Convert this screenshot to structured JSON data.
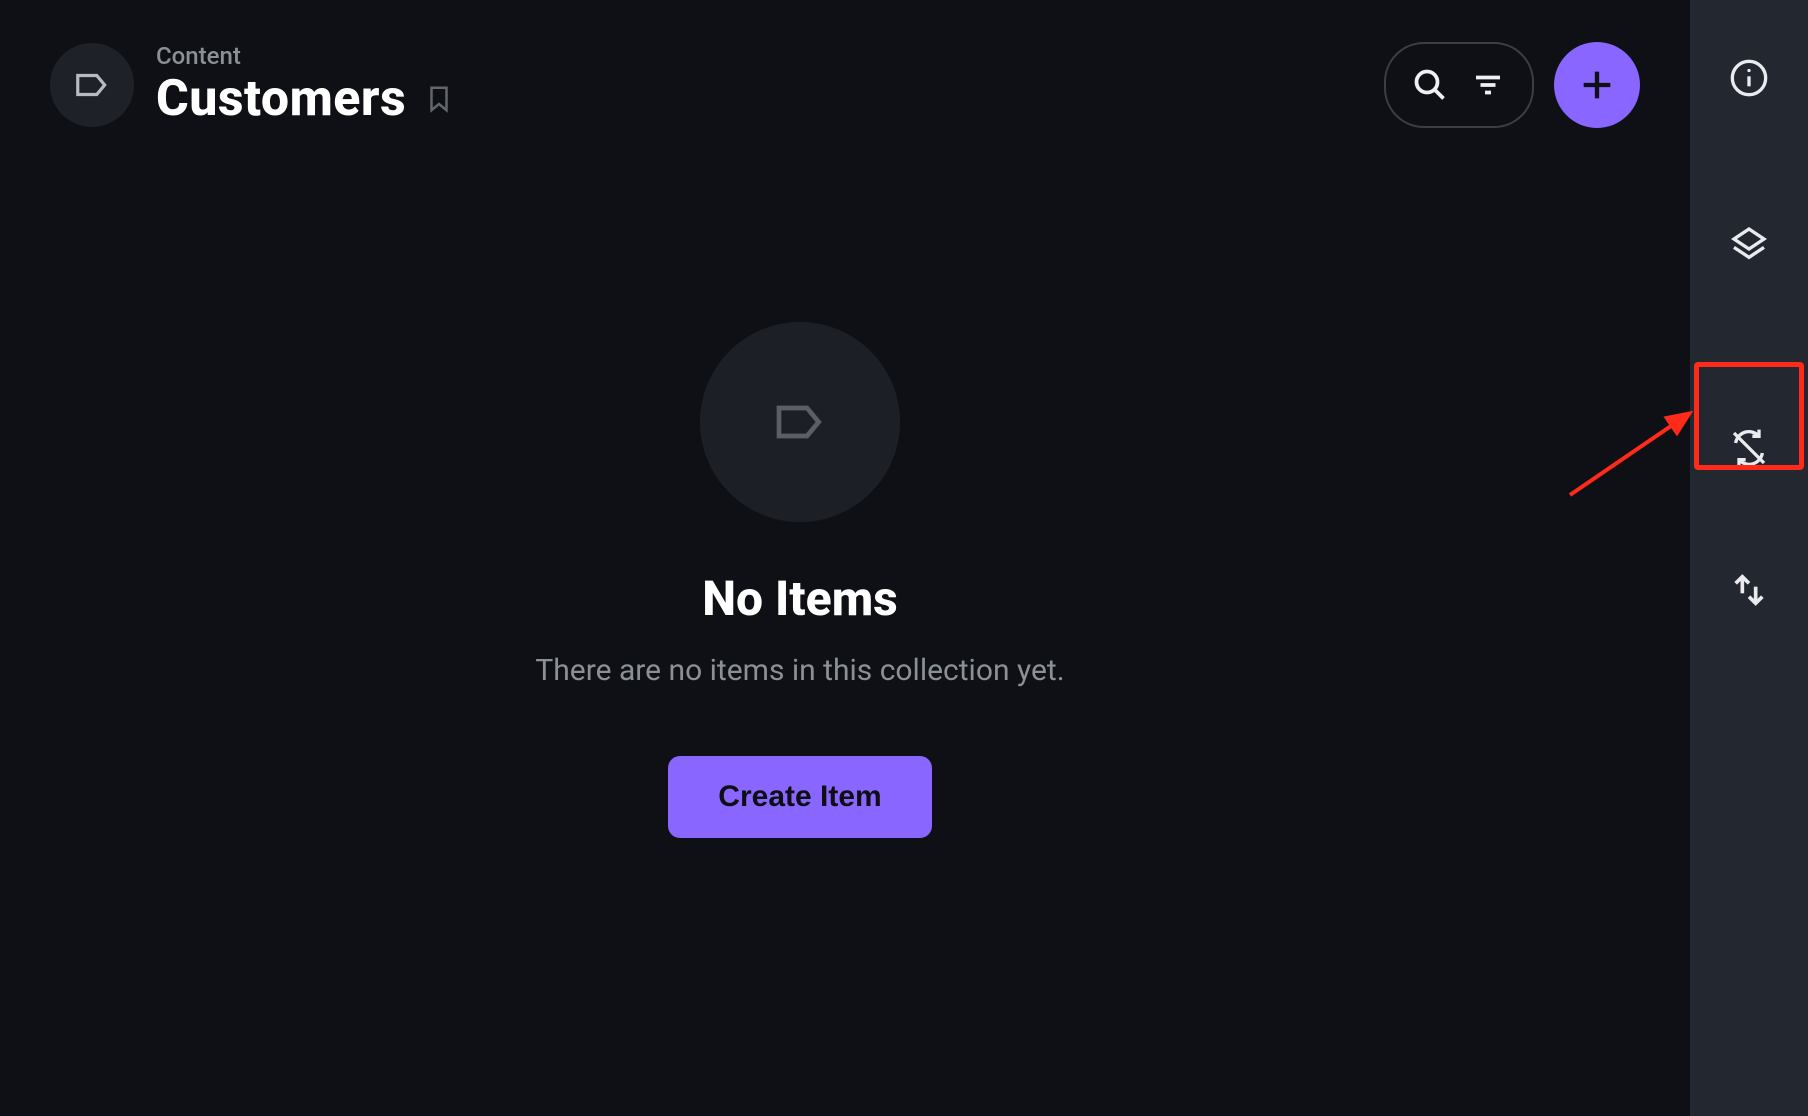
{
  "header": {
    "breadcrumb": "Content",
    "title": "Customers"
  },
  "empty_state": {
    "title": "No Items",
    "subtitle": "There are no items in this collection yet.",
    "button_label": "Create Item"
  },
  "colors": {
    "accent": "#8866ff",
    "annotation": "#ff2a1a"
  }
}
